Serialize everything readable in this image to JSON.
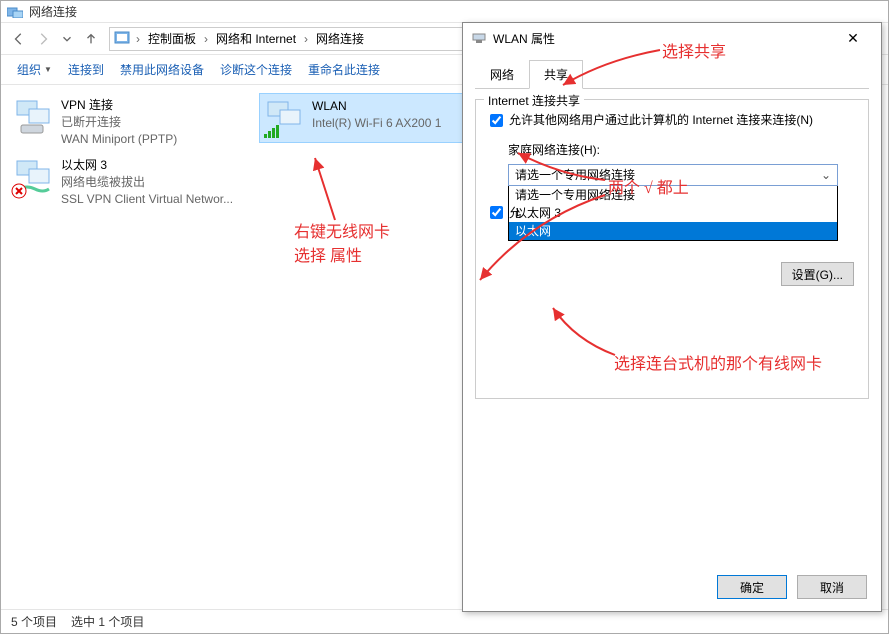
{
  "window": {
    "title": "网络连接"
  },
  "breadcrumb": {
    "item1": "控制面板",
    "item2": "网络和 Internet",
    "item3": "网络连接"
  },
  "toolbar": {
    "organize": "组织",
    "connect": "连接到",
    "disable": "禁用此网络设备",
    "diagnose": "诊断这个连接",
    "rename": "重命名此连接"
  },
  "connections": {
    "vpn": {
      "name": "VPN 连接",
      "status": "已断开连接",
      "device": "WAN Miniport (PPTP)"
    },
    "eth3": {
      "name": "以太网 3",
      "status": "网络电缆被拔出",
      "device": "SSL VPN Client Virtual Networ..."
    },
    "wlan": {
      "name": "WLAN",
      "status": "",
      "device": "Intel(R) Wi-Fi 6 AX200 1"
    }
  },
  "statusbar": {
    "count": "5 个项目",
    "selected": "选中 1 个项目"
  },
  "dialog": {
    "title": "WLAN 属性",
    "tabs": {
      "network": "网络",
      "sharing": "共享"
    },
    "group_title": "Internet 连接共享",
    "checkbox1": "允许其他网络用户通过此计算机的 Internet 连接来连接(N)",
    "home_label": "家庭网络连接(H):",
    "select_placeholder": "请选一个专用网络连接",
    "option1": "请选一个专用网络连接",
    "option2": "以太网 3",
    "option3": "以太网",
    "checkbox2_prefix": "允",
    "settings_btn": "设置(G)...",
    "ok": "确定",
    "cancel": "取消"
  },
  "annotations": {
    "a1": "选择共享",
    "a2_line1": "右键无线网卡",
    "a2_line2": "选择  属性",
    "a3": "两个 √ 都上",
    "a4": "选择连台式机的那个有线网卡"
  }
}
